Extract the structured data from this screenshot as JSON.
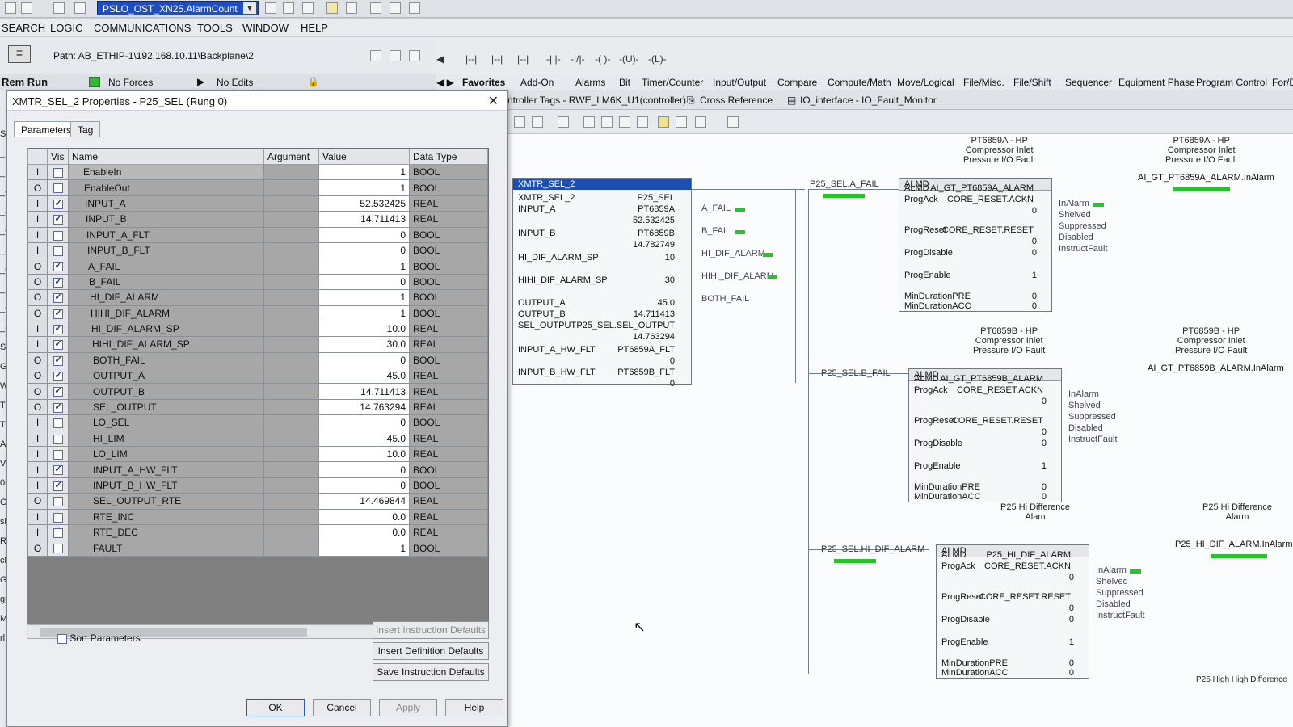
{
  "toolbar": {
    "tag_combo": "PSLO_OST_XN25.AlarmCount"
  },
  "menu": [
    "SEARCH",
    "LOGIC",
    "COMMUNICATIONS",
    "TOOLS",
    "WINDOW",
    "HELP"
  ],
  "path": "Path: AB_ETHIP-1\\192.168.10.11\\Backplane\\2",
  "status": {
    "mode": "Rem Run",
    "forces": "No Forces",
    "edits": "No Edits"
  },
  "instruction_tabs": [
    "Favorites",
    "Add-On",
    "Alarms",
    "Bit",
    "Timer/Counter",
    "Input/Output",
    "Compare",
    "Compute/Math",
    "Move/Logical",
    "File/Misc.",
    "File/Shift",
    "Sequencer",
    "Equipment Phase",
    "Program Control",
    "For/B"
  ],
  "ladder_icons": [
    "|--|",
    "|--|",
    "|--|",
    "-| |-",
    "-|/|-",
    "-( )-",
    "-(U)-",
    "-(L)-"
  ],
  "left_hints": [
    "SEL",
    "_L",
    "_10r",
    "_Q_1",
    "_SEL",
    "_C_20",
    "_SEL",
    "_C_40",
    "_EQ_8",
    "_C_80r",
    "_ns",
    "SEQUE",
    "GENER",
    "WATER",
    "TURBIN",
    "TOTALI",
    "AUX_1",
    "VIBRAT",
    "0mS",
    "G_FC_16",
    "sions",
    "Revisions",
    "cheduled",
    "Groups",
    "grouped",
    "Manager",
    "rl Model"
  ],
  "dialog": {
    "title": "XMTR_SEL_2 Properties - P25_SEL (Rung 0)",
    "tabs": [
      "Parameters",
      "Tag"
    ],
    "columns": [
      "Vis",
      "Name",
      "Argument",
      "Value",
      "Data Type"
    ],
    "rows": [
      {
        "io": "I",
        "vis": false,
        "name": "EnableIn",
        "value": "1",
        "type": "BOOL"
      },
      {
        "io": "O",
        "vis": false,
        "name": "EnableOut",
        "value": "1",
        "type": "BOOL"
      },
      {
        "io": "I",
        "vis": true,
        "name": "INPUT_A",
        "value": "52.532425",
        "type": "REAL"
      },
      {
        "io": "I",
        "vis": true,
        "name": "INPUT_B",
        "value": "14.711413",
        "type": "REAL"
      },
      {
        "io": "I",
        "vis": false,
        "name": "INPUT_A_FLT",
        "value": "0",
        "type": "BOOL"
      },
      {
        "io": "I",
        "vis": false,
        "name": "INPUT_B_FLT",
        "value": "0",
        "type": "BOOL"
      },
      {
        "io": "O",
        "vis": true,
        "name": "A_FAIL",
        "value": "1",
        "type": "BOOL"
      },
      {
        "io": "O",
        "vis": true,
        "name": "B_FAIL",
        "value": "0",
        "type": "BOOL"
      },
      {
        "io": "O",
        "vis": true,
        "name": "HI_DIF_ALARM",
        "value": "1",
        "type": "BOOL"
      },
      {
        "io": "O",
        "vis": true,
        "name": "HIHI_DIF_ALARM",
        "value": "1",
        "type": "BOOL"
      },
      {
        "io": "I",
        "vis": true,
        "name": "HI_DIF_ALARM_SP",
        "value": "10.0",
        "type": "REAL"
      },
      {
        "io": "I",
        "vis": true,
        "name": "HIHI_DIF_ALARM_SP",
        "value": "30.0",
        "type": "REAL"
      },
      {
        "io": "O",
        "vis": true,
        "name": "BOTH_FAIL",
        "value": "0",
        "type": "BOOL"
      },
      {
        "io": "O",
        "vis": true,
        "name": "OUTPUT_A",
        "value": "45.0",
        "type": "REAL"
      },
      {
        "io": "O",
        "vis": true,
        "name": "OUTPUT_B",
        "value": "14.711413",
        "type": "REAL"
      },
      {
        "io": "O",
        "vis": true,
        "name": "SEL_OUTPUT",
        "value": "14.763294",
        "type": "REAL"
      },
      {
        "io": "I",
        "vis": false,
        "name": "LO_SEL",
        "value": "0",
        "type": "BOOL"
      },
      {
        "io": "I",
        "vis": false,
        "name": "HI_LIM",
        "value": "45.0",
        "type": "REAL"
      },
      {
        "io": "I",
        "vis": false,
        "name": "LO_LIM",
        "value": "10.0",
        "type": "REAL"
      },
      {
        "io": "I",
        "vis": true,
        "name": "INPUT_A_HW_FLT",
        "value": "0",
        "type": "BOOL"
      },
      {
        "io": "I",
        "vis": true,
        "name": "INPUT_B_HW_FLT",
        "value": "0",
        "type": "BOOL"
      },
      {
        "io": "O",
        "vis": false,
        "name": "SEL_OUTPUT_RTE",
        "value": "14.469844",
        "type": "REAL"
      },
      {
        "io": "I",
        "vis": false,
        "name": "RTE_INC",
        "value": "0.0",
        "type": "REAL"
      },
      {
        "io": "I",
        "vis": false,
        "name": "RTE_DEC",
        "value": "0.0",
        "type": "REAL"
      },
      {
        "io": "O",
        "vis": false,
        "name": "FAULT",
        "value": "1",
        "type": "BOOL"
      }
    ],
    "sort_label": "Sort Parameters",
    "buttons": {
      "insert_instr": "Insert Instruction Defaults",
      "insert_def": "Insert Definition Defaults",
      "save_instr": "Save Instruction Defaults",
      "ok": "OK",
      "cancel": "Cancel",
      "apply": "Apply",
      "help": "Help"
    }
  },
  "ladder": {
    "tabs": [
      "ntroller Tags - RWE_LM6K_U1(controller)",
      "Cross Reference",
      "IO_interface - IO_Fault_Monitor"
    ],
    "xmtr": {
      "head": "XMTR_SEL_2",
      "rows": [
        [
          "XMTR_SEL_2",
          "P25_SEL"
        ],
        [
          "INPUT_A",
          "PT6859A"
        ],
        [
          "",
          "52.532425"
        ],
        [
          "INPUT_B",
          "PT6859B"
        ],
        [
          "",
          "14.782749"
        ],
        [
          "HI_DIF_ALARM_SP",
          "10"
        ],
        [
          "HIHI_DIF_ALARM_SP",
          "30"
        ],
        [
          "OUTPUT_A",
          "45.0"
        ],
        [
          "OUTPUT_B",
          "14.711413"
        ],
        [
          "SEL_OUTPUT",
          "P25_SEL.SEL_OUTPUT"
        ],
        [
          "",
          "14.763294"
        ],
        [
          "INPUT_A_HW_FLT",
          "PT6859A_FLT"
        ],
        [
          "",
          "0"
        ],
        [
          "INPUT_B_HW_FLT",
          "PT6859B_FLT"
        ],
        [
          "",
          "0"
        ]
      ],
      "outputs": [
        "A_FAIL",
        "B_FAIL",
        "HI_DIF_ALARM",
        "HIHI_DIF_ALARM",
        "BOTH_FAIL"
      ]
    },
    "contacts": [
      "P25_SEL.A_FAIL",
      "P25_SEL.B_FAIL",
      "P25_SEL.HI_DIF_ALARM"
    ],
    "almd": [
      {
        "desc": "PT6859A - HP\nCompressor Inlet\nPressure I/O Fault",
        "tag": "AI_GT_PT6859A_ALARM",
        "ack": "CORE_RESET.ACKN",
        "reset": "CORE_RESET.RESET",
        "ackv": "0",
        "resetv": "0",
        "disable": "0",
        "enable": "1",
        "pre": "0",
        "acc": "0",
        "rdesc": "PT6859A - HP\nCompressor Inlet\nPressure I/O Fault",
        "rtag": "AI_GT_PT6859A_ALARM.InAlarm"
      },
      {
        "desc": "PT6859B - HP\nCompressor Inlet\nPressure I/O Fault",
        "tag": "AI_GT_PT6859B_ALARM",
        "ack": "CORE_RESET.ACKN",
        "reset": "CORE_RESET.RESET",
        "ackv": "0",
        "resetv": "0",
        "disable": "0",
        "enable": "1",
        "pre": "0",
        "acc": "0",
        "rdesc": "PT6859B - HP\nCompressor Inlet\nPressure I/O Fault",
        "rtag": "AI_GT_PT6859B_ALARM.InAlarm"
      },
      {
        "desc": "P25 Hi Difference\nAlam",
        "tag": "P25_HI_DIF_ALARM",
        "ack": "CORE_RESET.ACKN",
        "reset": "CORE_RESET.RESET",
        "ackv": "0",
        "resetv": "0",
        "disable": "0",
        "enable": "1",
        "pre": "0",
        "acc": "0",
        "rdesc": "P25 Hi Difference\nAlarm",
        "rtag": "P25_HI_DIF_ALARM.InAlarm"
      }
    ],
    "almd_outputs": [
      "InAlarm",
      "Shelved",
      "Suppressed",
      "Disabled",
      "InstructFault"
    ],
    "almd_labels": {
      "head": "ALMD",
      "almd": "ALMD",
      "ack": "ProgAck",
      "reset": "ProgReset",
      "disable": "ProgDisable",
      "enable": "ProgEnable",
      "pre": "MinDurationPRE",
      "acc": "MinDurationACC"
    },
    "bottom_note": "P25 High High\nDifference"
  }
}
